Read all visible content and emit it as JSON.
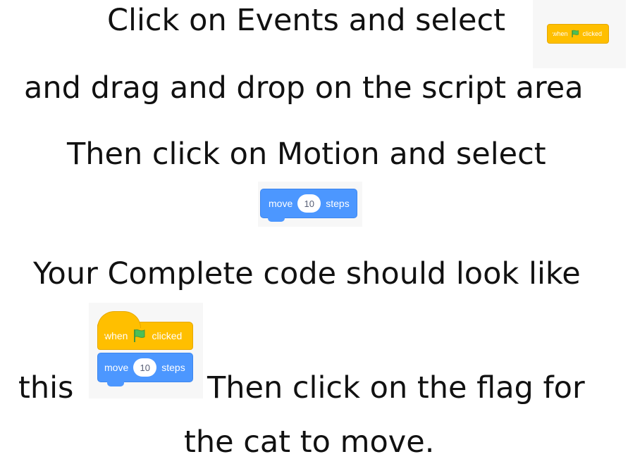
{
  "instructions": {
    "line1": "Click on Events and select",
    "line2": "and drag and drop on the script area",
    "line3": "Then click on Motion and select",
    "line4": "Your Complete code should look like",
    "line5_start": "this",
    "line5_end": "Then click on the flag for",
    "line6": "the cat to move."
  },
  "blocks": {
    "event_when": "when",
    "event_clicked": "clicked",
    "flag_icon": "green-flag-icon",
    "motion_move": "move",
    "motion_steps_value": "10",
    "motion_steps": "steps"
  },
  "colors": {
    "events": "#ffbf00",
    "motion": "#4c97ff",
    "flag": "#4cbf56",
    "text": "#111111"
  }
}
